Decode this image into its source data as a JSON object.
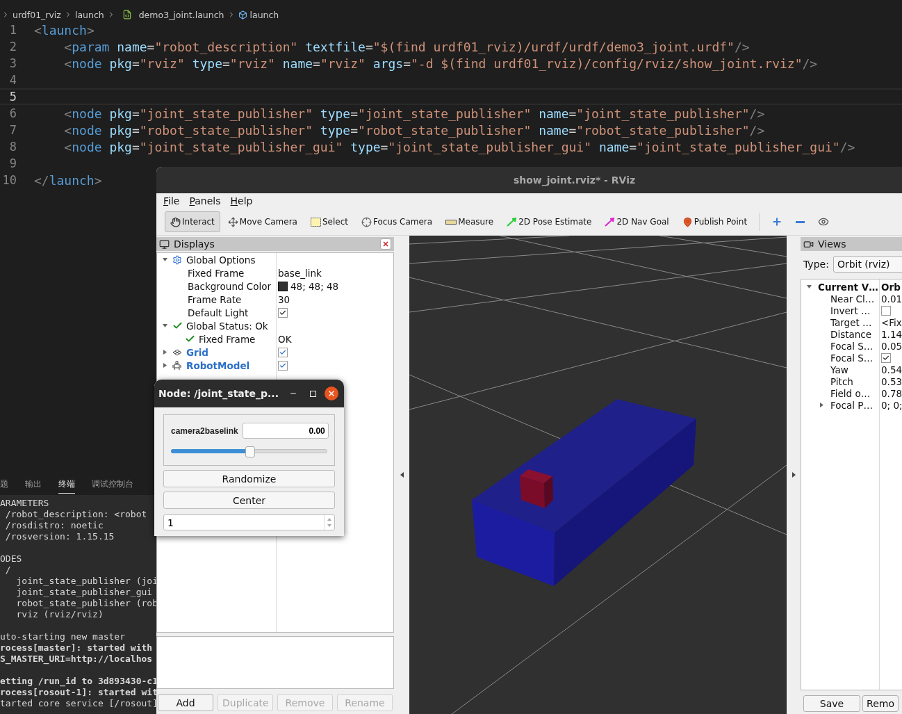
{
  "editor": {
    "breadcrumb": [
      {
        "label": "urdf01_rviz",
        "kind": "folder"
      },
      {
        "label": "launch",
        "kind": "folder"
      },
      {
        "label": "demo3_joint.launch",
        "kind": "file"
      },
      {
        "label": "launch",
        "kind": "symbol"
      }
    ],
    "lines": [
      {
        "number": "1",
        "code": "<launch>",
        "current": false
      },
      {
        "number": "2",
        "code": "    <param name=\"robot_description\" textfile=\"$(find urdf01_rviz)/urdf/urdf/demo3_joint.urdf\"/>",
        "current": false
      },
      {
        "number": "3",
        "code": "    <node pkg=\"rviz\" type=\"rviz\" name=\"rviz\" args=\"-d $(find urdf01_rviz)/config/rviz/show_joint.rviz\"/>",
        "current": false
      },
      {
        "number": "4",
        "current": false
      },
      {
        "number": "5",
        "current": true
      },
      {
        "number": "6",
        "code": "    <node pkg=\"joint_state_publisher\" type=\"joint_state_publisher\" name=\"joint_state_publisher\"/>",
        "current": false
      },
      {
        "number": "7",
        "code": "    <node pkg=\"robot_state_publisher\" type=\"robot_state_publisher\" name=\"robot_state_publisher\"/>",
        "current": false
      },
      {
        "number": "8",
        "code": "    <node pkg=\"joint_state_publisher_gui\" type=\"joint_state_publisher_gui\" name=\"joint_state_publisher_gui\"/>",
        "current": false
      },
      {
        "number": "9",
        "current": false
      },
      {
        "number": "10",
        "code": "</launch>",
        "current": false
      }
    ]
  },
  "terminal": {
    "tabs": [
      {
        "label": "题",
        "selected": false
      },
      {
        "label": "输出",
        "selected": false
      },
      {
        "label": "终端",
        "selected": true
      },
      {
        "label": "调试控制台",
        "selected": false
      }
    ],
    "lines": [
      {
        "kind": "normal",
        "text": "ARAMETERS"
      },
      {
        "kind": "normal",
        "text": " /robot_description: <robot"
      },
      {
        "kind": "normal",
        "text": " /rosdistro: noetic"
      },
      {
        "kind": "normal",
        "text": " /rosversion: 1.15.15"
      },
      {
        "kind": "blank"
      },
      {
        "kind": "normal",
        "text": "ODES"
      },
      {
        "kind": "normal",
        "text": " /"
      },
      {
        "kind": "normal",
        "text": "   joint_state_publisher (joi"
      },
      {
        "kind": "normal",
        "text": "   joint_state_publisher_gui"
      },
      {
        "kind": "normal",
        "text": "   robot_state_publisher (rob"
      },
      {
        "kind": "normal",
        "text": "   rviz (rviz/rviz)"
      },
      {
        "kind": "blank"
      },
      {
        "kind": "normal",
        "text": "uto-starting new master"
      },
      {
        "kind": "bold",
        "text": "rocess[master]: started with"
      },
      {
        "kind": "bold",
        "text": "S_MASTER_URI=http://localhos"
      },
      {
        "kind": "blank"
      },
      {
        "kind": "bold",
        "text": "etting /run_id to 3d893430-c1"
      },
      {
        "kind": "bold",
        "text": "rocess[rosout-1]: started wit"
      },
      {
        "kind": "normal",
        "text": "tarted core service [/rosout]"
      }
    ]
  },
  "rviz": {
    "title": "show_joint.rviz* - RViz",
    "menu": [
      "File",
      "Panels",
      "Help"
    ],
    "tools": [
      {
        "label": "Interact",
        "kind": "interact",
        "selected": true
      },
      {
        "label": "Move Camera",
        "kind": "move_camera",
        "selected": false
      },
      {
        "label": "Select",
        "kind": "select",
        "selected": false
      },
      {
        "label": "Focus Camera",
        "kind": "focus_camera",
        "selected": false
      },
      {
        "label": "Measure",
        "kind": "measure",
        "selected": false
      },
      {
        "label": "2D Pose Estimate",
        "kind": "pose_estimate",
        "selected": false
      },
      {
        "label": "2D Nav Goal",
        "kind": "nav_goal",
        "selected": false
      },
      {
        "label": "Publish Point",
        "kind": "publish_point",
        "selected": false
      }
    ],
    "displays": {
      "title": "Displays",
      "items": [
        {
          "label": "Global Options",
          "kind": "global_options",
          "expanded": true,
          "children": [
            {
              "label": "Fixed Frame",
              "kind": "text",
              "value": "base_link"
            },
            {
              "label": "Background Color",
              "kind": "color",
              "value": "48; 48; 48",
              "color": "#303030"
            },
            {
              "label": "Frame Rate",
              "kind": "text",
              "value": "30"
            },
            {
              "label": "Default Light",
              "kind": "checkbox",
              "checked": true
            }
          ]
        },
        {
          "label": "Global Status: Ok",
          "kind": "global_status",
          "expanded": true,
          "children": [
            {
              "label": "Fixed Frame",
              "kind": "status",
              "value": "OK"
            }
          ]
        },
        {
          "label": "Grid",
          "kind": "grid",
          "expanded": false,
          "checked": true
        },
        {
          "label": "RobotModel",
          "kind": "robot_model",
          "expanded": false,
          "checked": true
        }
      ],
      "buttons": [
        {
          "label": "Add",
          "disabled": false
        },
        {
          "label": "Duplicate",
          "disabled": true
        },
        {
          "label": "Remove",
          "disabled": true
        },
        {
          "label": "Rename",
          "disabled": true
        }
      ]
    },
    "views": {
      "title": "Views",
      "type_label": "Type:",
      "type_value": "Orbit (rviz)",
      "current": {
        "label": "Current V…",
        "value": "Orb",
        "expanded": true,
        "children": [
          {
            "label": "Near Cl…",
            "kind": "text",
            "value": "0.01"
          },
          {
            "label": "Invert …",
            "kind": "checkbox",
            "checked": false
          },
          {
            "label": "Target …",
            "kind": "text",
            "value": "<Fix"
          },
          {
            "label": "Distance",
            "kind": "text",
            "value": "1.14"
          },
          {
            "label": "Focal S…",
            "kind": "text",
            "value": "0.05"
          },
          {
            "label": "Focal S…",
            "kind": "checkbox",
            "checked": true
          },
          {
            "label": "Yaw",
            "kind": "text",
            "value": "0.54"
          },
          {
            "label": "Pitch",
            "kind": "text",
            "value": "0.53"
          },
          {
            "label": "Field o…",
            "kind": "text",
            "value": "0.78"
          },
          {
            "label": "Focal P…",
            "kind": "text",
            "value": "0; 0;",
            "expanded": false
          }
        ]
      },
      "buttons": [
        {
          "label": "Save"
        },
        {
          "label": "Remo"
        }
      ]
    }
  },
  "joint_dialog": {
    "title": "Node: /joint_state_p...",
    "joint": {
      "name": "camera2baselink",
      "value": "0.00",
      "level": 0.5
    },
    "buttons": [
      "Randomize",
      "Center"
    ],
    "spin_value": "1"
  }
}
